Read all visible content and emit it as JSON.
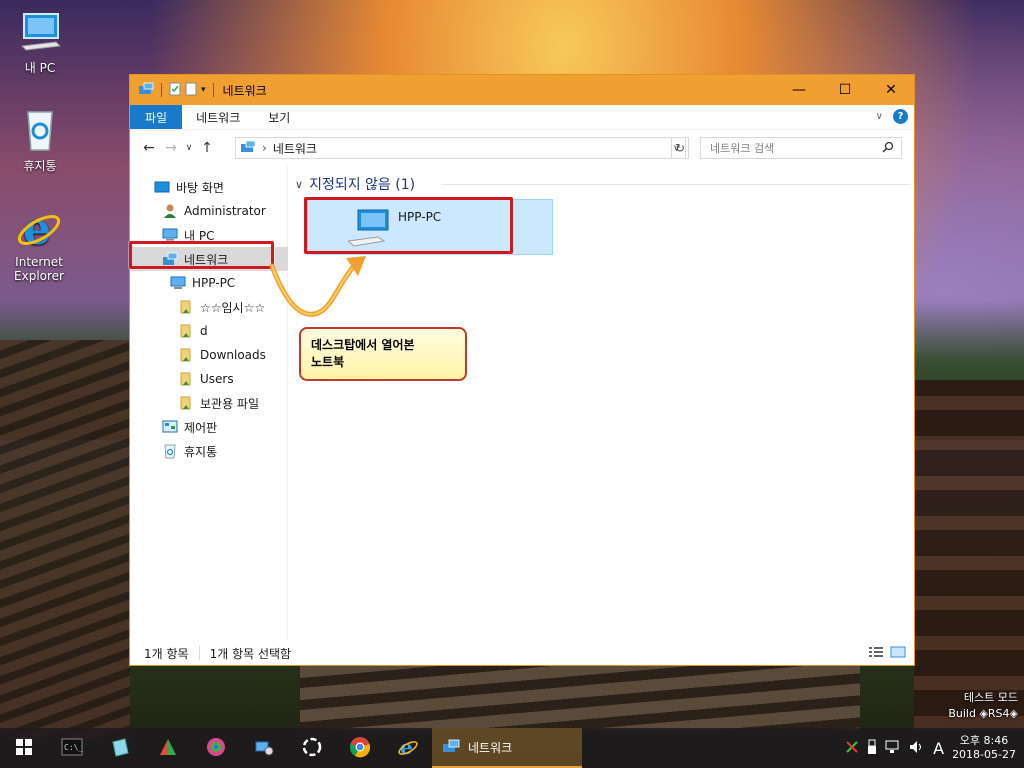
{
  "desktop": {
    "icons": [
      {
        "label": "내 PC"
      },
      {
        "label": "휴지통"
      },
      {
        "label": "Internet Explorer"
      }
    ],
    "watermark": {
      "line1": "테스트 모드",
      "line2": "Build ◈RS4◈"
    }
  },
  "window": {
    "title": "네트워크",
    "controls": {
      "minimize": "—",
      "maximize": "☐",
      "close": "✕"
    },
    "ribbon_tabs": [
      "파일",
      "네트워크",
      "보기"
    ],
    "address": {
      "path": "네트워크"
    },
    "search": {
      "placeholder": "네트워크 검색"
    },
    "nav_pane": [
      {
        "label": "바탕 화면"
      },
      {
        "label": "Administrator"
      },
      {
        "label": "내 PC"
      },
      {
        "label": "네트워크",
        "selected": true
      },
      {
        "label": "HPP-PC"
      },
      {
        "label": "☆☆임시☆☆"
      },
      {
        "label": "d"
      },
      {
        "label": "Downloads"
      },
      {
        "label": "Users"
      },
      {
        "label": "보관용 파일"
      },
      {
        "label": "제어판"
      },
      {
        "label": "휴지통"
      }
    ],
    "group": {
      "header": "지정되지 않음 (1)"
    },
    "items": [
      {
        "name": "HPP-PC"
      }
    ],
    "status": {
      "count": "1개 항목",
      "selected": "1개 항목 선택함"
    }
  },
  "annotation": {
    "callout_line1": "데스크탑에서 열어본",
    "callout_line2": "노트북"
  },
  "taskbar": {
    "active_app": "네트워크",
    "ime": "A",
    "clock": {
      "time": "오후 8:46",
      "date": "2018-05-27"
    }
  },
  "colors": {
    "titlebar": "#f0a030",
    "accent": "#1979ca",
    "annotation": "#d0191f"
  }
}
